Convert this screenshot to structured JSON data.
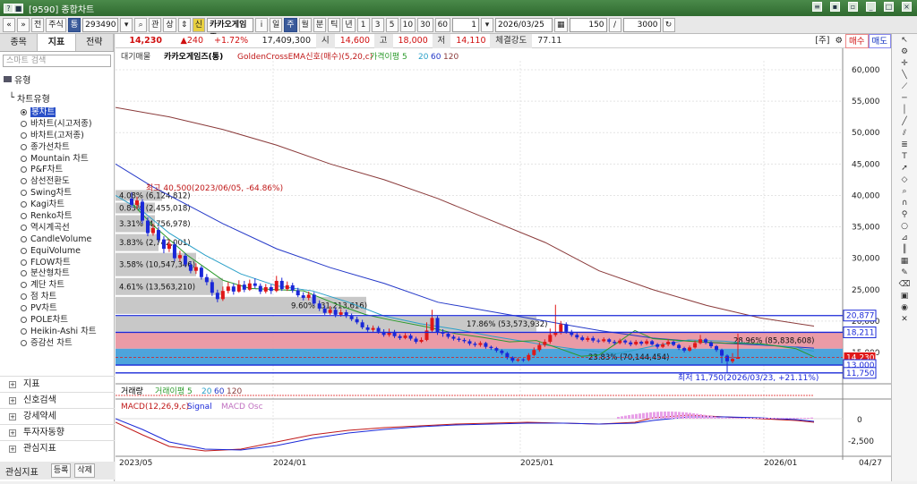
{
  "window": {
    "title": "[9590] 종합차트"
  },
  "toolbar": {
    "prev": "«",
    "next": "»",
    "jeon": "전",
    "stock": "주식",
    "market_badge": "통",
    "code": "293490",
    "gwan": "관",
    "sang": "상",
    "sin_badge": "신",
    "name": "카카오게임즈",
    "info": "i",
    "il": "일",
    "ju": "주",
    "wol": "월",
    "bun": "분",
    "tik": "틱",
    "nyeon": "년",
    "periods": [
      "1",
      "3",
      "5",
      "10",
      "30",
      "60"
    ],
    "interval": "1",
    "date": "2026/03/25",
    "count": "150",
    "count2": "3000"
  },
  "left_panel": {
    "tabs": [
      "종목",
      "지표",
      "전략"
    ],
    "active_tab": 1,
    "search_placeholder": "스마트 검색",
    "section_type": "유형",
    "section_chart_type": "차트유형",
    "items": [
      "봉차트",
      "바차트(시고저종)",
      "바차트(고저종)",
      "종가선차트",
      "Mountain 차트",
      "P&F차트",
      "삼선전환도",
      "Swing차트",
      "Kagi차트",
      "Renko차트",
      "역시계곡선",
      "CandleVolume",
      "EquiVolume",
      "FLOW차트",
      "분산형차트",
      "계단 차트",
      "점 차트",
      "PV차트",
      "POLE차트",
      "Heikin-Ashi 차트",
      "증감선 차트"
    ],
    "bottom": [
      "지표",
      "신호검색",
      "강세약세",
      "투자자동향",
      "관심지표"
    ],
    "footer_label": "관심지표",
    "footer_btn1": "등록",
    "footer_btn2": "삭제"
  },
  "pricebar": {
    "price": "14,230",
    "change": "▲240",
    "pct": "+1.72%",
    "volume": "17,409,300",
    "open_label": "시",
    "open": "14,600",
    "high_label": "고",
    "high": "18,000",
    "low_label": "저",
    "low": "14,110",
    "strength_label": "체결강도",
    "strength": "77.11",
    "mode": "[주]",
    "buy": "매수",
    "sell": "매도"
  },
  "legend": {
    "t0": "대기매물",
    "t1": "카카오게임즈(통)",
    "t2": "GoldenCrossEMA신호(매수)(5,20,c)",
    "t3": "가격이평 5",
    "t4": "20",
    "t5": "60",
    "t6": "120"
  },
  "annotations": {
    "high": "최고 40,500(2023/06/05, -64.86%)",
    "low": "최저 11,750(2026/03/23, +21.11%)"
  },
  "price_axis": {
    "ticks": [
      "60,000",
      "55,000",
      "50,000",
      "45,000",
      "40,000",
      "35,000",
      "30,000",
      "25,000",
      "20,000",
      "15,000"
    ],
    "tag_20877": "20,877",
    "tag_18211": "18,211",
    "tag_current": "14,230",
    "tag_13000": "13,000",
    "tag_11750": "11,750"
  },
  "supply_rows": [
    {
      "label": "4.08% (6,124,812)"
    },
    {
      "label": "0.83% (2,455,018)"
    },
    {
      "label": "3.31% (4,756,978)"
    },
    {
      "label": "3.83% (2,742,001)"
    },
    {
      "label": "3.58% (10,547,346)"
    },
    {
      "label": "4.61% (13,563,210)"
    },
    {
      "label": "9.60% (31,213,616)"
    },
    {
      "label": "17.86% (53,573,932)"
    },
    {
      "label": "28.96% (85,838,608)"
    },
    {
      "label": "23.83% (70,144,454)"
    }
  ],
  "volume_panel": {
    "t0": "거래량",
    "t1": "거래이평 5",
    "t2": "20",
    "t3": "60",
    "t4": "120"
  },
  "macd_panel": {
    "t0": "MACD(12,26,9,c)",
    "t1": "Signal",
    "t2": "MACD Osc",
    "tick0": "0",
    "tick1": "-2,500"
  },
  "x_axis": {
    "labels": [
      "2023/05",
      "2024/01",
      "2025/01",
      "2026/01"
    ],
    "end_label": "04/27"
  },
  "colors": {
    "up": "#e01818",
    "down": "#1a28d8",
    "ma5": "#2a9a2a",
    "ma20": "#2aa0c8",
    "ma60": "#2438c8",
    "ma120": "#8a3a3a",
    "pink_zone": "#e8909c",
    "blue_zone": "#3a9ad8"
  }
}
